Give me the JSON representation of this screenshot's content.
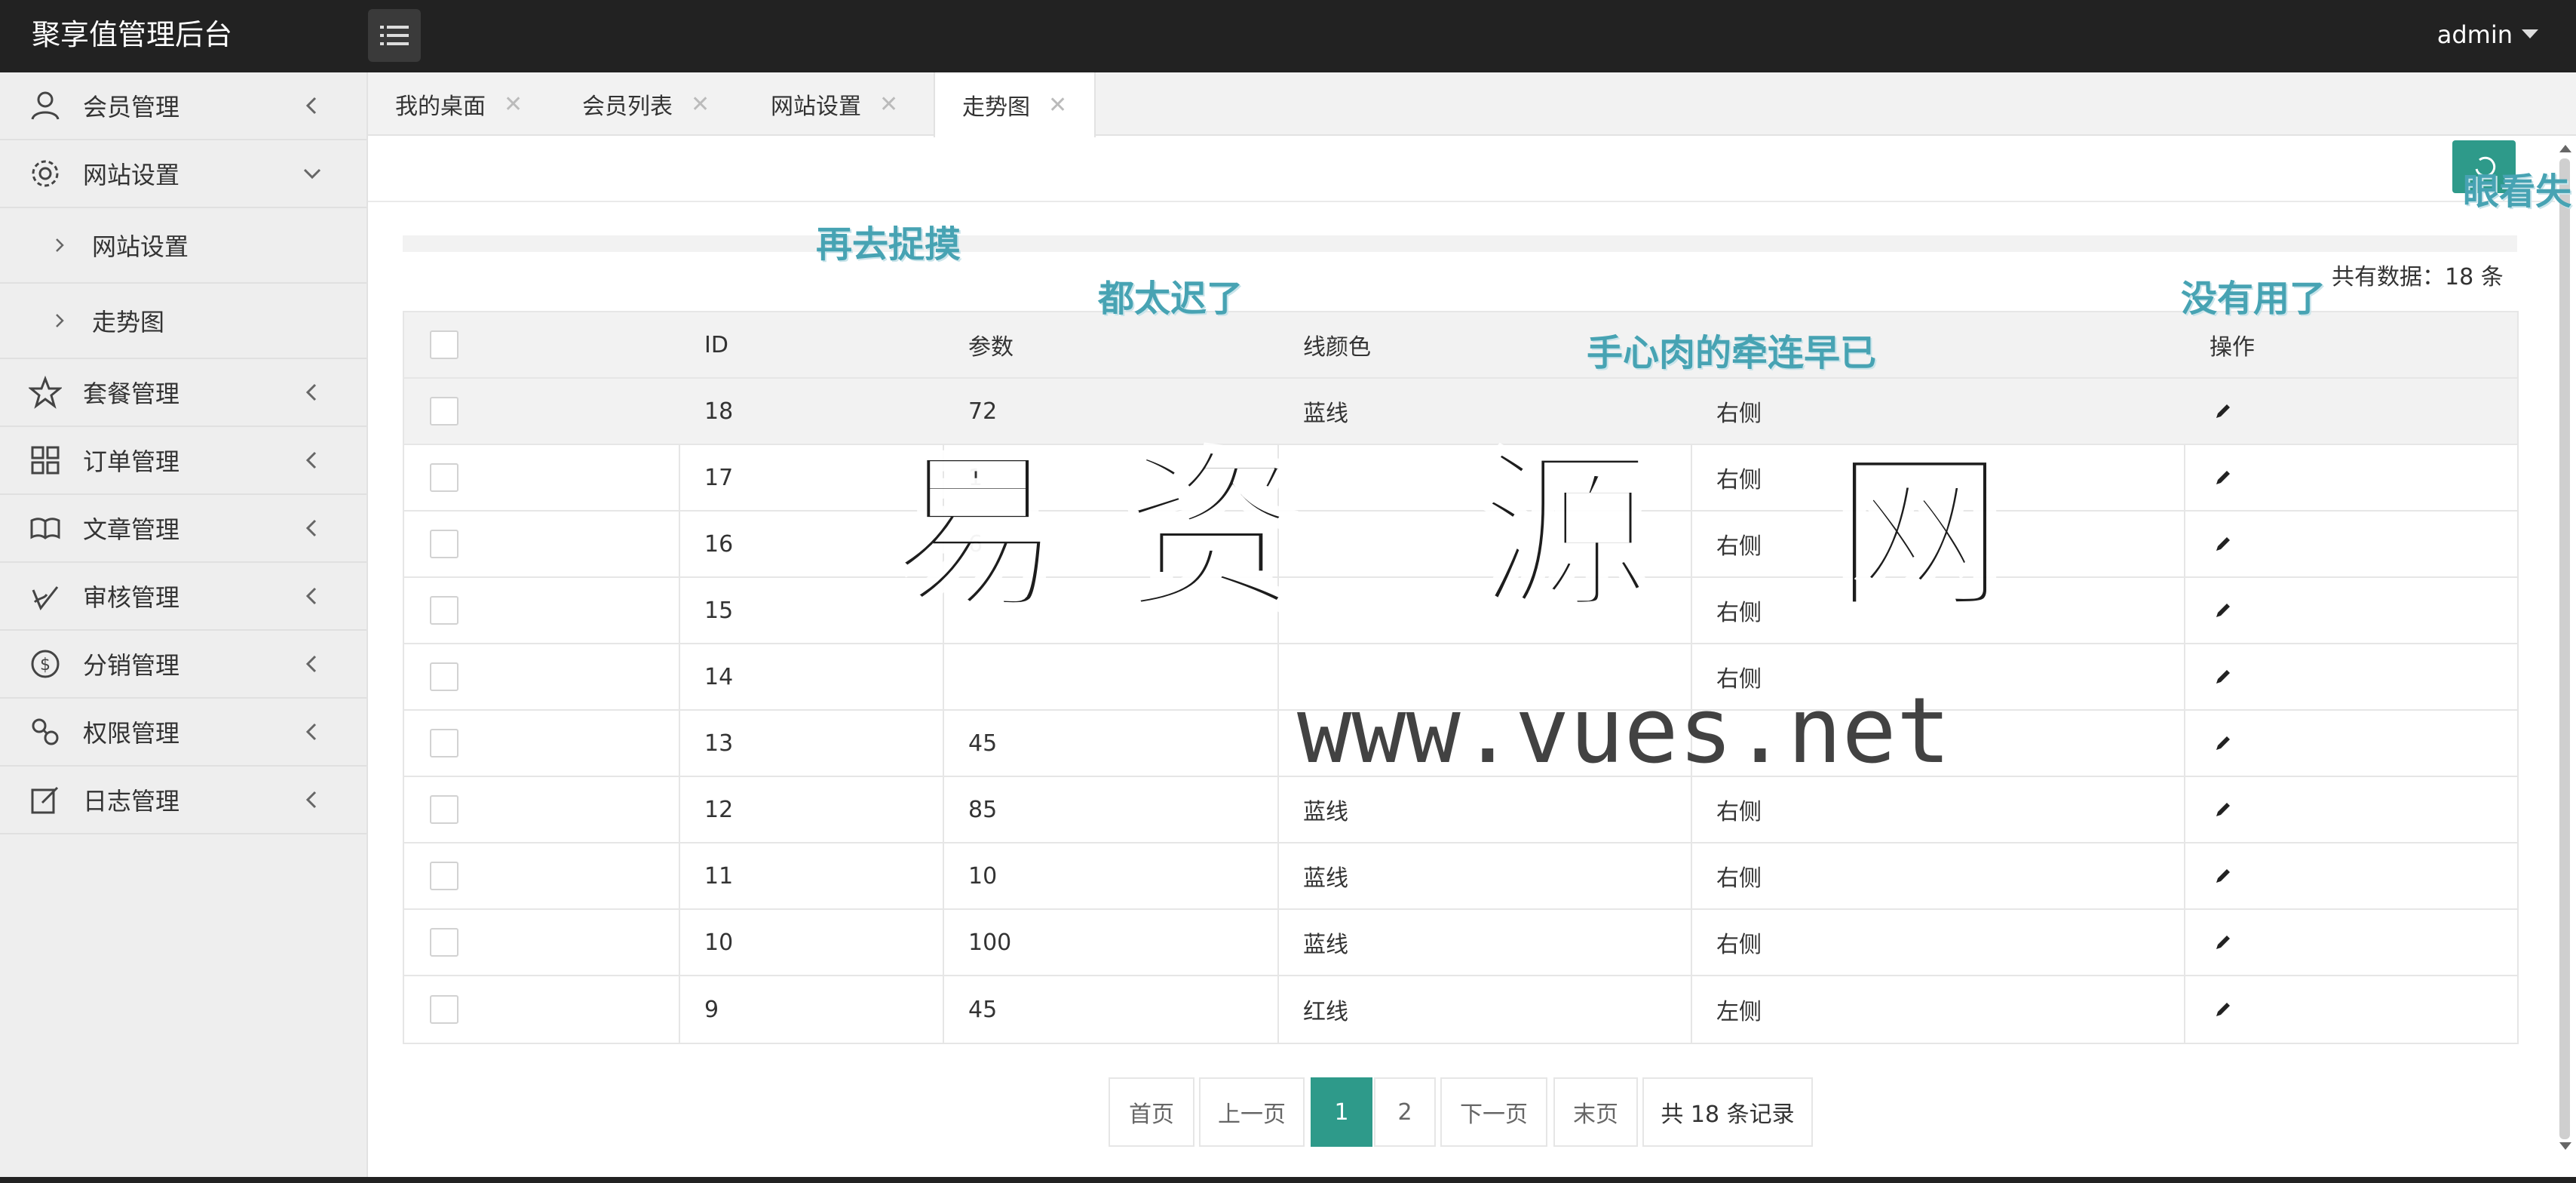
{
  "app": {
    "title": "聚享值管理后台",
    "user": "admin"
  },
  "sidebar": {
    "items": [
      {
        "label": "会员管理",
        "icon": "user-icon",
        "chevron": "left"
      },
      {
        "label": "网站设置",
        "icon": "gear-icon",
        "chevron": "down"
      },
      {
        "label": "网站设置",
        "sub": true
      },
      {
        "label": "走势图",
        "sub": true
      },
      {
        "label": "套餐管理",
        "icon": "star-icon",
        "chevron": "left"
      },
      {
        "label": "订单管理",
        "icon": "grid-icon",
        "chevron": "left"
      },
      {
        "label": "文章管理",
        "icon": "book-icon",
        "chevron": "left"
      },
      {
        "label": "审核管理",
        "icon": "stamp-icon",
        "chevron": "left"
      },
      {
        "label": "分销管理",
        "icon": "dollar-icon",
        "chevron": "left"
      },
      {
        "label": "权限管理",
        "icon": "link-icon",
        "chevron": "left"
      },
      {
        "label": "日志管理",
        "icon": "edit-icon",
        "chevron": "left"
      }
    ]
  },
  "tabs": [
    {
      "label": "我的桌面"
    },
    {
      "label": "会员列表"
    },
    {
      "label": "网站设置"
    },
    {
      "label": "走势图",
      "active": true
    }
  ],
  "summary": {
    "total": "共有数据：18 条"
  },
  "table": {
    "headers": [
      "ID",
      "参数",
      "线颜色",
      "",
      "操作"
    ],
    "rows": [
      {
        "id": "18",
        "param": "72",
        "color": "蓝线",
        "side": "右侧"
      },
      {
        "id": "17",
        "param": "1",
        "color": "",
        "side": "右侧"
      },
      {
        "id": "16",
        "param": "6",
        "color": "",
        "side": "右侧"
      },
      {
        "id": "15",
        "param": "",
        "color": "",
        "side": "右侧"
      },
      {
        "id": "14",
        "param": "",
        "color": "",
        "side": "右侧"
      },
      {
        "id": "13",
        "param": "45",
        "color": "",
        "side": ""
      },
      {
        "id": "12",
        "param": "85",
        "color": "蓝线",
        "side": "右侧"
      },
      {
        "id": "11",
        "param": "10",
        "color": "蓝线",
        "side": "右侧"
      },
      {
        "id": "10",
        "param": "100",
        "color": "蓝线",
        "side": "右侧"
      },
      {
        "id": "9",
        "param": "45",
        "color": "红线",
        "side": "左侧"
      }
    ]
  },
  "pagination": {
    "first": "首页",
    "prev": "上一页",
    "page1": "1",
    "page2": "2",
    "next": "下一页",
    "last": "末页",
    "info": "共 18 条记录"
  },
  "overlay": {
    "lyrics": [
      "再去捉摸",
      "都太迟了",
      "手心肉的牵连早已",
      "没有用了",
      "眼看失"
    ],
    "watermark": "易资 源 网",
    "url": "www.vues.net"
  },
  "colors": {
    "accent": "#2e9a8a",
    "topbar": "#222222",
    "sidebar": "#eeeeee"
  }
}
